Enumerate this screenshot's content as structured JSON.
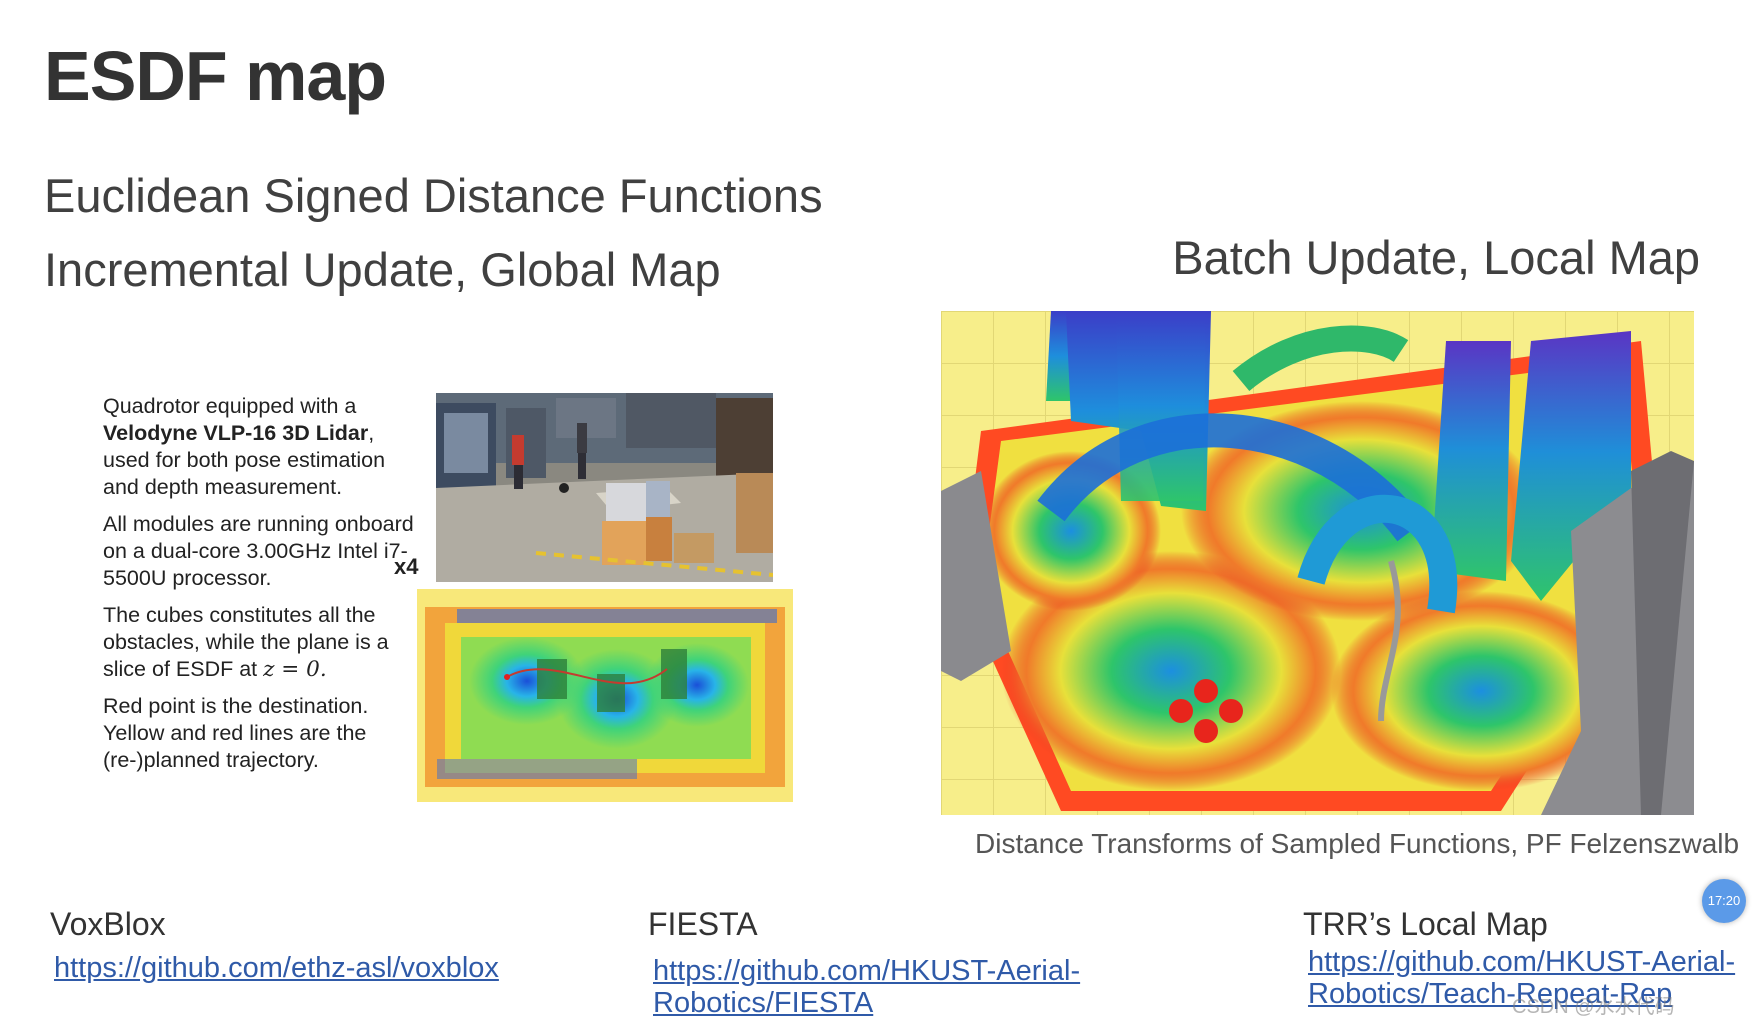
{
  "slide": {
    "title": "ESDF map",
    "subtitle_1": "Euclidean Signed Distance Functions",
    "subtitle_2": "Incremental Update, Global Map",
    "subtitle_right": "Batch Update, Local Map"
  },
  "description": {
    "p1_a": "Quadrotor equipped with a",
    "p1_bold": "Velodyne VLP-16 3D Lidar",
    "p1_b": ", used for both pose estimation and depth measurement.",
    "p2": "All modules are running onboard on a dual-core 3.00GHz Intel i7-5500U processor.",
    "p3_a": "The cubes constitutes all the obstacles, while the plane is a slice of ESDF at",
    "p3_math": "z = 0.",
    "p4": "Red point is the destination. Yellow and red lines are the (re-)planned trajectory.",
    "speed_badge": "x4"
  },
  "caption": "Distance Transforms of Sampled Functions, PF Felzenszwalb",
  "links": [
    {
      "title": "VoxBlox",
      "url_line1": "https://github.com/ethz-asl/voxblox",
      "url_line2": ""
    },
    {
      "title": "FIESTA",
      "url_line1": "https://github.com/HKUST-Aerial-",
      "url_line2": "Robotics/FIESTA"
    },
    {
      "title": "TRR’s Local Map",
      "url_line1": "https://github.com/HKUST-Aerial-",
      "url_line2": "Robotics/Teach-Repeat-Rep"
    }
  ],
  "overlay": {
    "timer": "17:20",
    "watermark": "CSDN @水水代码"
  },
  "colors": {
    "link": "#2f5aa8",
    "timer_bg": "#5b9ae8",
    "floor_yellow": "#f7ee8a"
  }
}
